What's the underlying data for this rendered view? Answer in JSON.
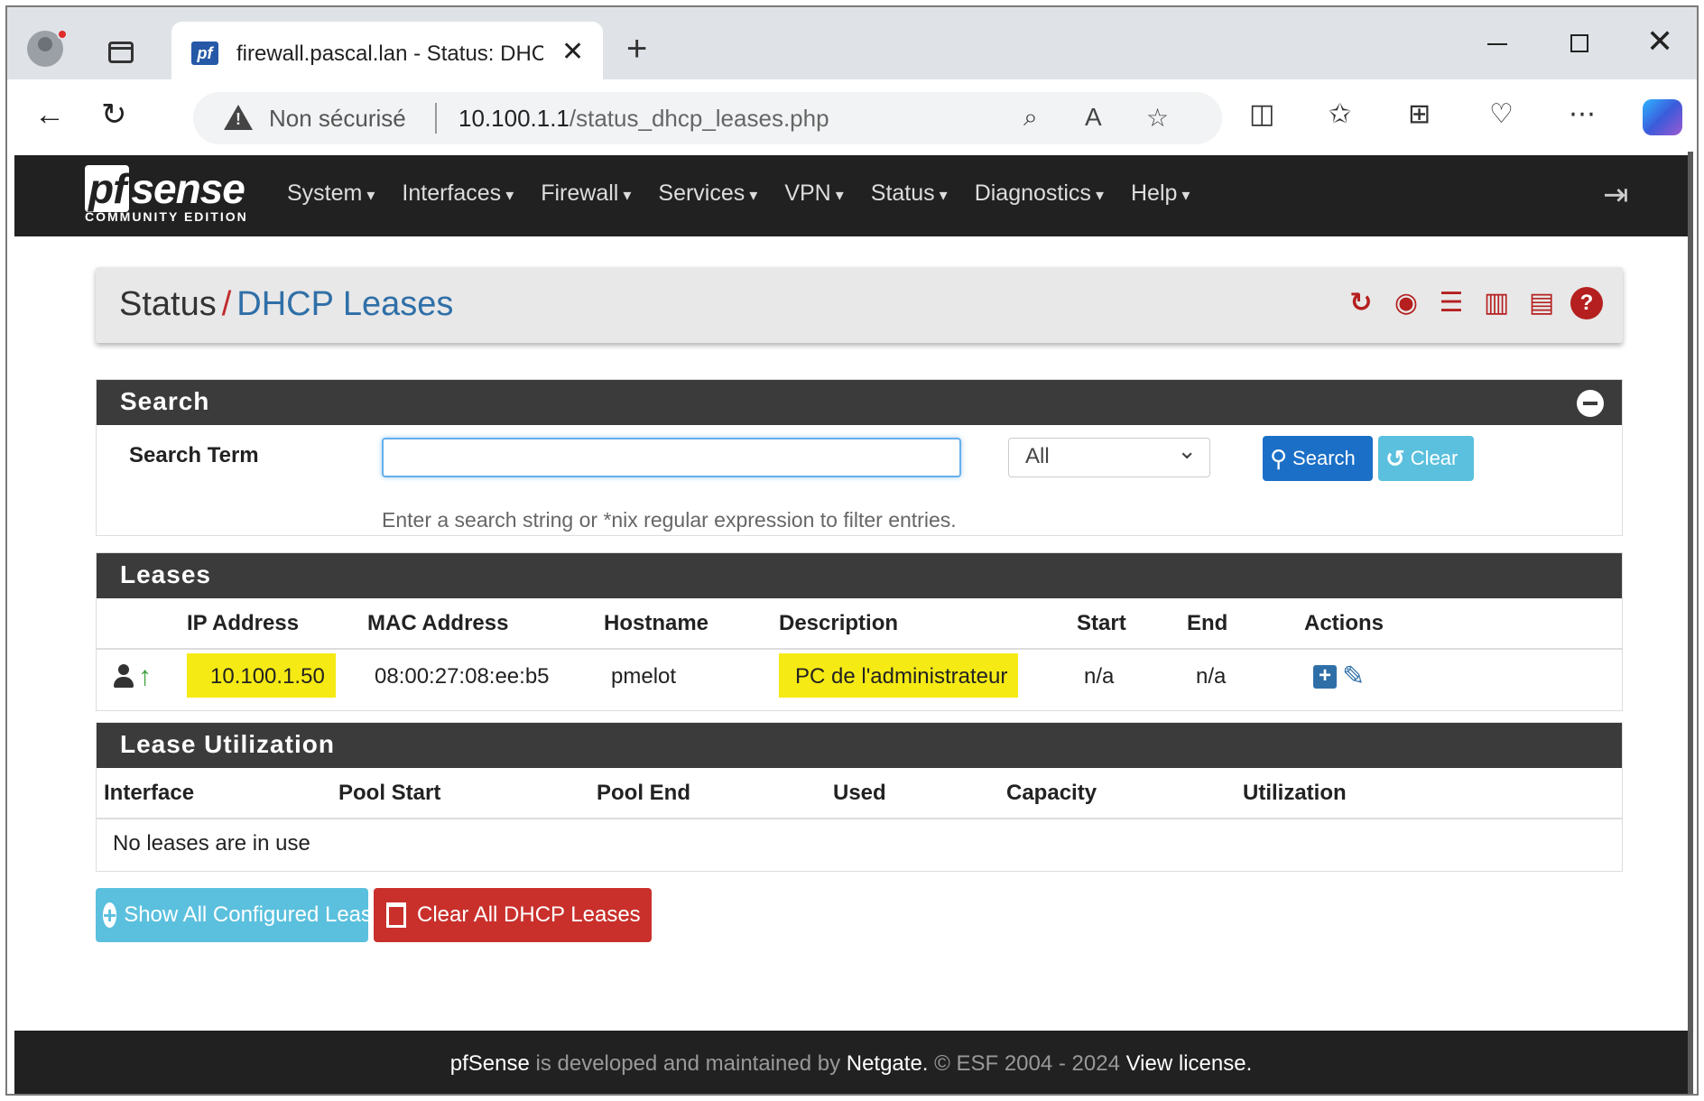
{
  "browser": {
    "tab_title": "firewall.pascal.lan - Status: DHCP",
    "tab_favicon": "pf",
    "not_secure": "Non sécurisé",
    "url_host": "10.100.1.1",
    "url_path": "/status_dhcp_leases.php"
  },
  "nav": {
    "logo_main": "sense",
    "logo_pf": "pf",
    "logo_sub": "COMMUNITY EDITION",
    "menu": [
      "System",
      "Interfaces",
      "Firewall",
      "Services",
      "VPN",
      "Status",
      "Diagnostics",
      "Help"
    ]
  },
  "breadcrumb": {
    "section": "Status",
    "separator": "/",
    "current": "DHCP Leases"
  },
  "search": {
    "heading": "Search",
    "label": "Search Term",
    "input_value": "",
    "select_value": "All",
    "search_button": "Search",
    "clear_button": "Clear",
    "help_text": "Enter a search string or *nix regular expression to filter entries."
  },
  "leases": {
    "heading": "Leases",
    "columns": [
      "IP Address",
      "MAC Address",
      "Hostname",
      "Description",
      "Start",
      "End",
      "Actions"
    ],
    "rows": [
      {
        "ip": "10.100.1.50",
        "mac": "08:00:27:08:ee:b5",
        "hostname": "pmelot",
        "description": "PC de l'administrateur",
        "start": "n/a",
        "end": "n/a"
      }
    ]
  },
  "utilization": {
    "heading": "Lease Utilization",
    "columns": [
      "Interface",
      "Pool Start",
      "Pool End",
      "Used",
      "Capacity",
      "Utilization"
    ],
    "empty_text": "No leases are in use"
  },
  "actions": {
    "show_all": "Show All Configured Leases",
    "clear_all": "Clear All DHCP Leases"
  },
  "footer": {
    "brand": "pfSense",
    "text1": " is developed and maintained by ",
    "company": "Netgate.",
    "text2": " © ESF 2004 - 2024 ",
    "license": "View license."
  },
  "colors": {
    "highlight": "#f5ea14",
    "header_bg": "#212121",
    "panel_head": "#3b3b3b",
    "link_blue": "#2f6fa8",
    "danger_red": "#c9302c",
    "info_cyan": "#5bc0de"
  }
}
